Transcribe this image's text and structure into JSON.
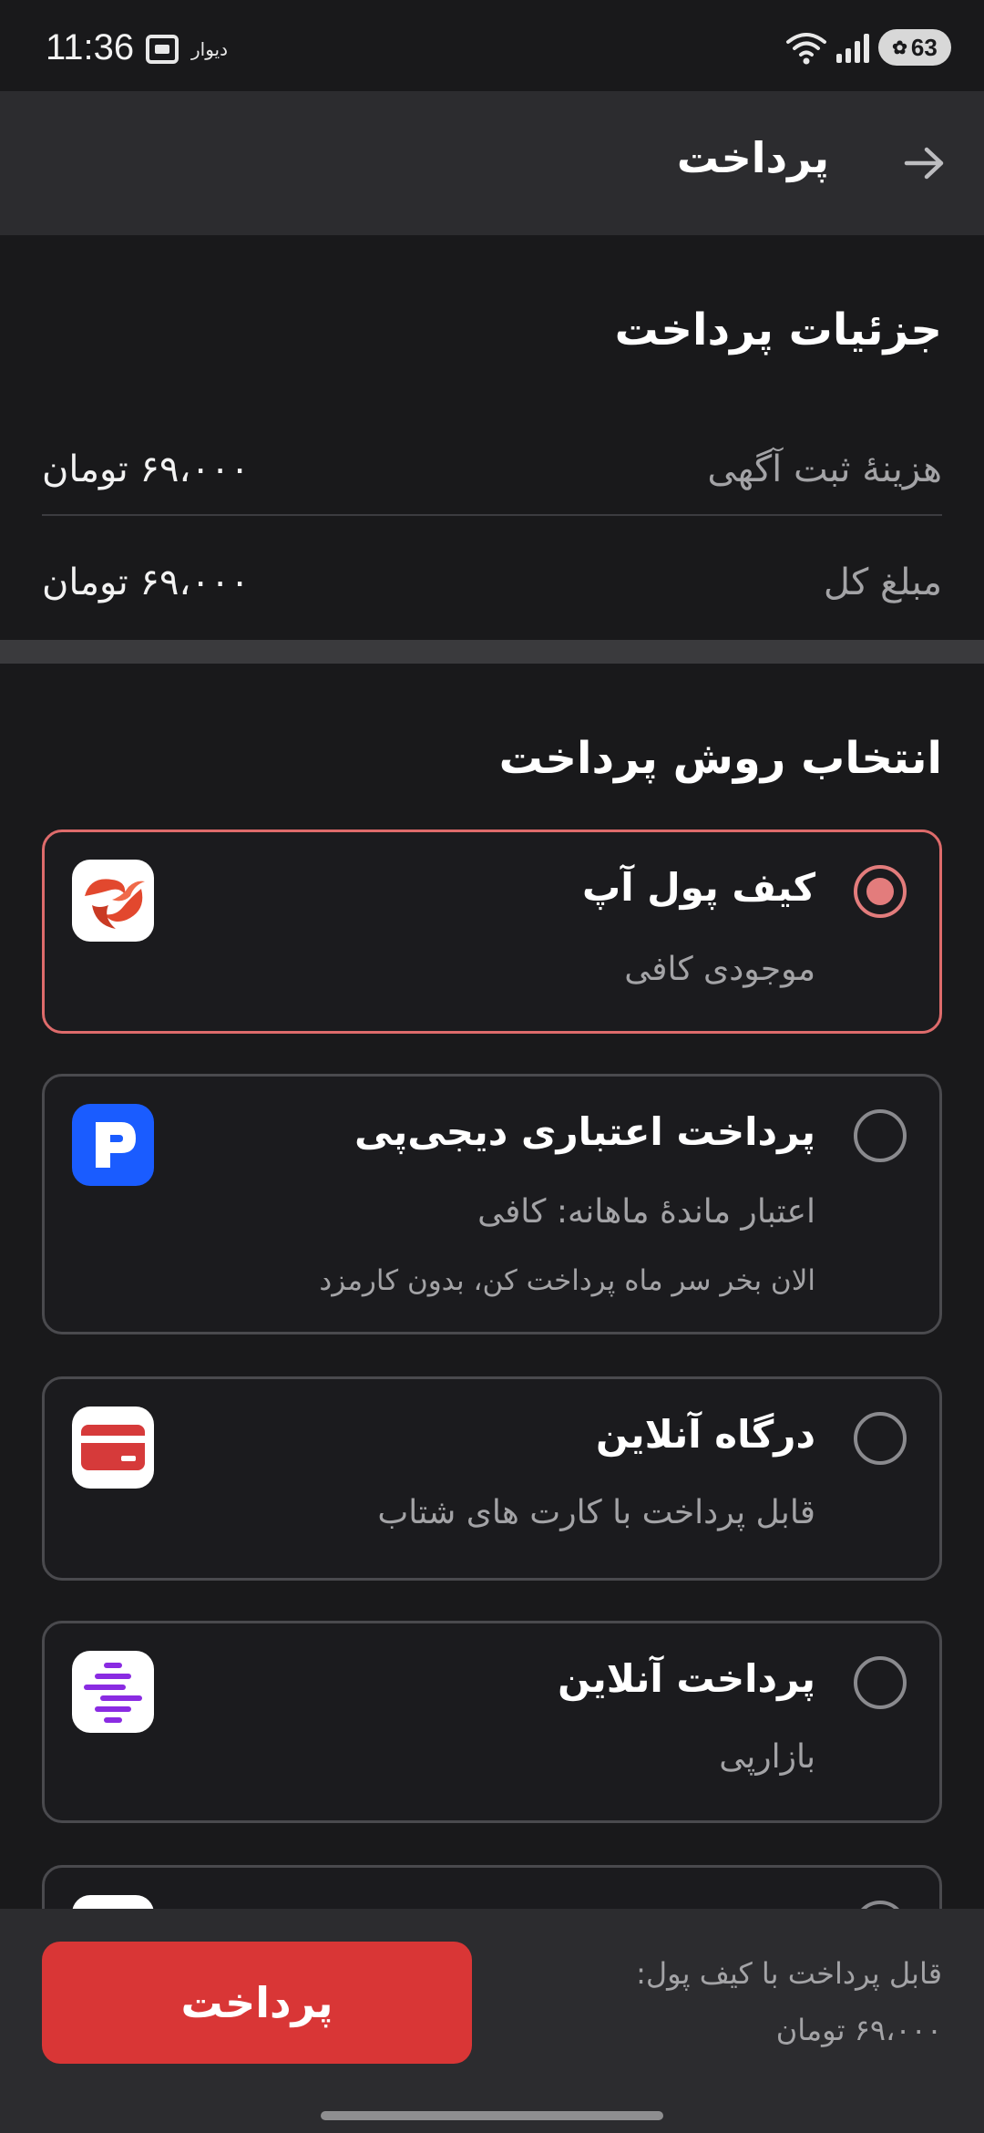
{
  "status_bar": {
    "time": "11:36",
    "app_label": "دیوار",
    "battery": "63",
    "icons": [
      "screenshot-icon",
      "wifi-icon",
      "signal-icon",
      "battery-icon"
    ]
  },
  "header": {
    "title": "پرداخت",
    "back_icon": "arrow-right-icon"
  },
  "details": {
    "title": "جزئیات پرداخت",
    "rows": [
      {
        "label": "هزینهٔ ثبت آگهی",
        "value": "۶۹،۰۰۰ تومان"
      },
      {
        "label": "مبلغ کل",
        "value": "۶۹،۰۰۰ تومان"
      }
    ]
  },
  "methods": {
    "title": "انتخاب روش پرداخت",
    "items": [
      {
        "title": "کیف پول آپ",
        "subtitle": "موجودی کافی",
        "selected": true,
        "logo": "ap-wallet-logo",
        "logo_bg": "#ffffff"
      },
      {
        "title": "پرداخت اعتباری دیجی‌پی",
        "subtitle": "اعتبار ماندهٔ ماهانه: کافی",
        "subtitle2": "الان بخر سر ماه پرداخت کن، بدون کارمزد",
        "selected": false,
        "logo": "digipay-logo",
        "logo_bg": "#1a5cff"
      },
      {
        "title": "درگاه آنلاین",
        "subtitle": "قابل پرداخت با کارت های شتاب",
        "selected": false,
        "logo": "bank-card-logo",
        "logo_bg": "#ffffff"
      },
      {
        "title": "پرداخت آنلاین",
        "subtitle": "بازارپی",
        "selected": false,
        "logo": "bazaarpay-logo",
        "logo_bg": "#ffffff"
      }
    ]
  },
  "footer": {
    "pay_label": "پرداخت",
    "caption": "قابل پرداخت با کیف پول:",
    "amount": "۶۹،۰۰۰ تومان"
  },
  "colors": {
    "background": "#19191b",
    "surface": "#2c2c2f",
    "accent": "#d93636",
    "selected_border": "#de6b6b"
  }
}
